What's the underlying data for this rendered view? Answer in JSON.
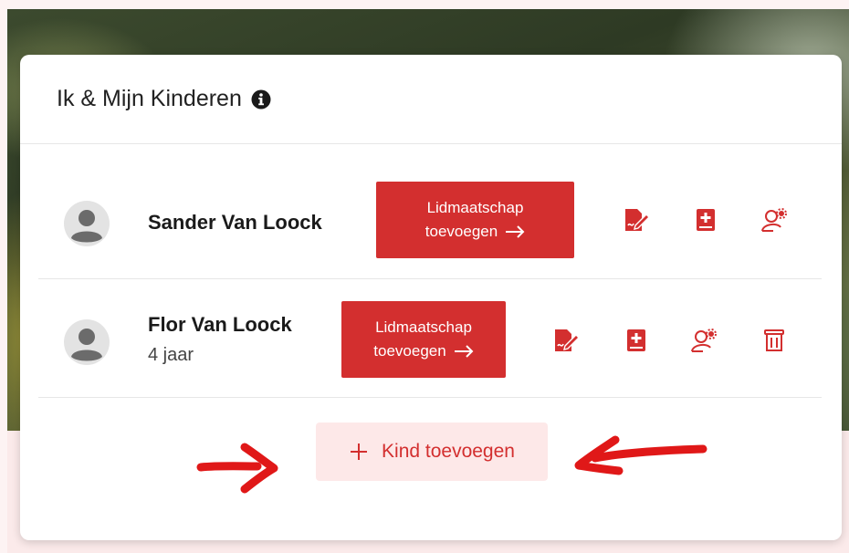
{
  "card": {
    "title": "Ik & Mijn Kinderen",
    "info_icon": "info-circle-icon"
  },
  "members": [
    {
      "name": "Sander Van Loock",
      "age": "",
      "membership_line1": "Lidmaatschap",
      "membership_line2": "toevoegen",
      "actions": [
        "edit-document-icon",
        "medical-book-icon",
        "user-settings-icon"
      ]
    },
    {
      "name": "Flor Van Loock",
      "age": "4 jaar",
      "membership_line1": "Lidmaatschap",
      "membership_line2": "toevoegen",
      "actions": [
        "edit-document-icon",
        "medical-book-icon",
        "user-settings-icon",
        "trash-icon"
      ]
    }
  ],
  "add_child": {
    "label": "Kind toevoegen",
    "icon": "plus-icon"
  },
  "colors": {
    "primary": "#d32f2f",
    "light_primary": "#fde8e8",
    "annotation_arrow": "#e01818"
  }
}
